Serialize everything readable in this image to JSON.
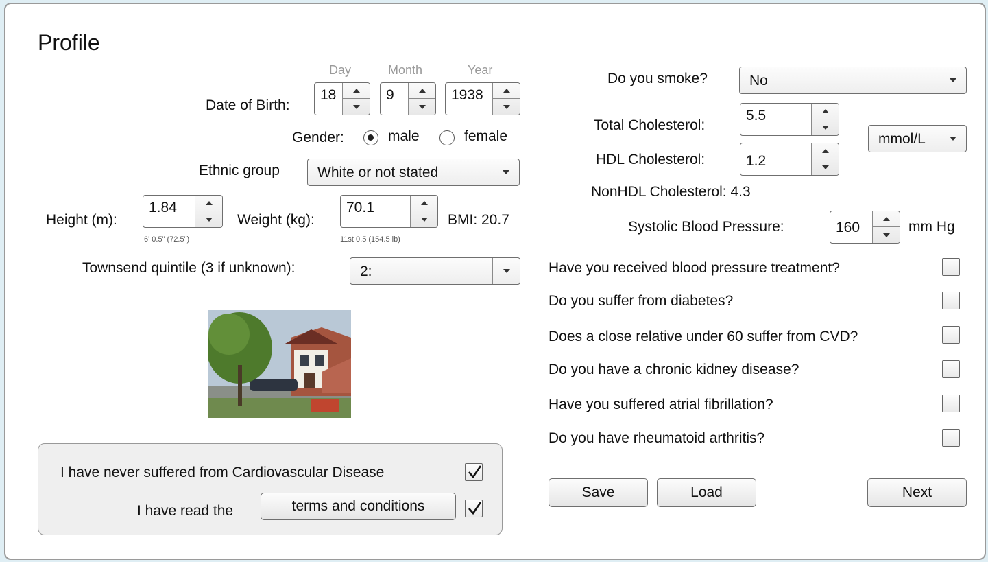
{
  "page": {
    "title": "Profile"
  },
  "dob": {
    "label": "Date of Birth:",
    "day_header": "Day",
    "month_header": "Month",
    "year_header": "Year",
    "day": "18",
    "month": "9",
    "year": "1938"
  },
  "gender": {
    "label": "Gender:",
    "options": [
      "male",
      "female"
    ],
    "selected": "male"
  },
  "ethnic": {
    "label": "Ethnic group",
    "value": "White or not stated"
  },
  "height": {
    "label": "Height (m):",
    "value": "1.84",
    "imperial": "6' 0.5\" (72.5\")"
  },
  "weight": {
    "label": "Weight (kg):",
    "value": "70.1",
    "imperial": "11st 0.5 (154.5 lb)"
  },
  "bmi": {
    "text": "BMI: 20.7"
  },
  "townsend": {
    "label": "Townsend quintile (3 if unknown):",
    "value": "2:"
  },
  "panel": {
    "never_cvd": "I have never suffered from Cardiovascular Disease",
    "read_terms": "I have read the",
    "terms_button": "terms and conditions"
  },
  "smoke": {
    "label": "Do you smoke?",
    "value": "No"
  },
  "cholesterol": {
    "total_label": "Total Cholesterol:",
    "total_value": "5.5",
    "hdl_label": "HDL Cholesterol:",
    "hdl_value": "1.2",
    "unit": "mmol/L",
    "nonhdl_text": "NonHDL Cholesterol: 4.3"
  },
  "bp": {
    "label": "Systolic Blood Pressure:",
    "value": "160",
    "unit": "mm Hg"
  },
  "questions": [
    {
      "text": "Have you received blood pressure treatment?",
      "checked": false
    },
    {
      "text": "Do you suffer from diabetes?",
      "checked": false
    },
    {
      "text": "Does a close relative under 60 suffer from CVD?",
      "checked": false
    },
    {
      "text": "Do you have a chronic kidney disease?",
      "checked": false
    },
    {
      "text": "Have you suffered atrial fibrillation?",
      "checked": false
    },
    {
      "text": "Do you have rheumatoid arthritis?",
      "checked": false
    }
  ],
  "actions": {
    "save": "Save",
    "load": "Load",
    "next": "Next"
  },
  "colors": {
    "window_bg": "#ffffff",
    "page_bg": "#dfeef4",
    "panel_bg": "#efefef",
    "border": "#9a9a9a"
  }
}
